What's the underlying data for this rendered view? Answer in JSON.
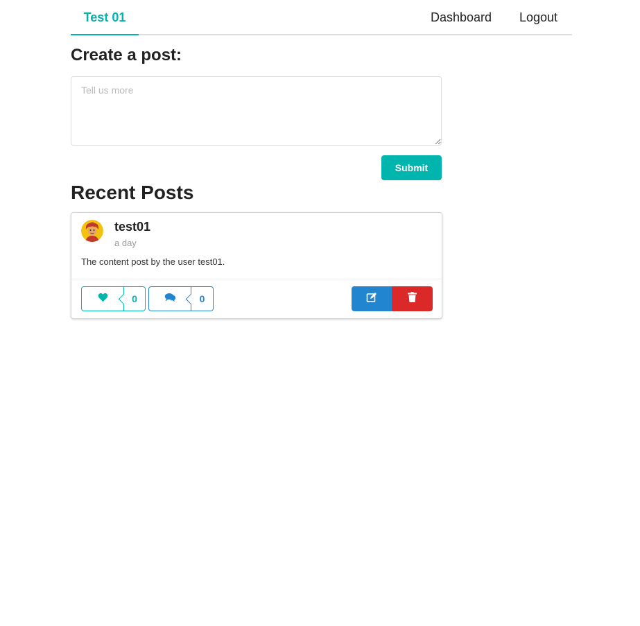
{
  "nav": {
    "brand": "Test 01",
    "dashboard": "Dashboard",
    "logout": "Logout"
  },
  "create": {
    "heading": "Create a post:",
    "placeholder": "Tell us more",
    "submit_label": "Submit"
  },
  "recent": {
    "heading": "Recent Posts"
  },
  "posts": [
    {
      "author": "test01",
      "time": "a day",
      "content": "The content post by the user test01.",
      "likes": "0",
      "comments": "0"
    }
  ],
  "icons": {
    "like": "heart-icon",
    "comment": "comments-icon",
    "edit": "edit-icon",
    "delete": "trash-icon",
    "avatar": "user-avatar"
  },
  "colors": {
    "teal": "#00b5ad",
    "blue": "#2185d0",
    "red": "#db2828"
  }
}
